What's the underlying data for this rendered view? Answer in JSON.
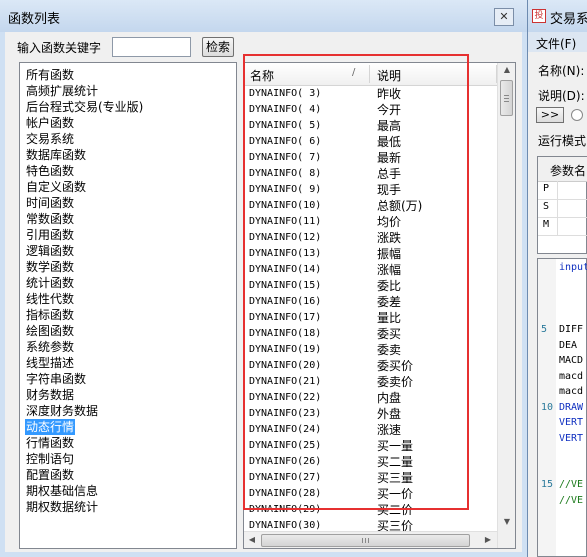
{
  "dialog": {
    "title": "函数列表",
    "close_glyph": "✕",
    "search_label": "输入函数关键字",
    "search_value": "",
    "search_button": "检索"
  },
  "categories": [
    "所有函数",
    "高频扩展统计",
    "后台程式交易(专业版)",
    "帐户函数",
    "交易系统",
    "数据库函数",
    "特色函数",
    "自定义函数",
    "时间函数",
    "常数函数",
    "引用函数",
    "逻辑函数",
    "数学函数",
    "统计函数",
    "线性代数",
    "指标函数",
    "绘图函数",
    "系统参数",
    "线型描述",
    "字符串函数",
    "财务数据",
    "深度财务数据",
    "动态行情",
    "行情函数",
    "控制语句",
    "配置函数",
    "期权基础信息",
    "期权数据统计"
  ],
  "selected_category_index": 22,
  "table": {
    "columns": {
      "name": "名称",
      "sort_glyph": "/",
      "desc": "说明"
    },
    "rows": [
      {
        "name": "DYNAINFO( 3)",
        "desc": "昨收"
      },
      {
        "name": "DYNAINFO( 4)",
        "desc": "今开"
      },
      {
        "name": "DYNAINFO( 5)",
        "desc": "最高"
      },
      {
        "name": "DYNAINFO( 6)",
        "desc": "最低"
      },
      {
        "name": "DYNAINFO( 7)",
        "desc": "最新"
      },
      {
        "name": "DYNAINFO( 8)",
        "desc": "总手"
      },
      {
        "name": "DYNAINFO( 9)",
        "desc": "现手"
      },
      {
        "name": "DYNAINFO(10)",
        "desc": "总额(万)"
      },
      {
        "name": "DYNAINFO(11)",
        "desc": "均价"
      },
      {
        "name": "DYNAINFO(12)",
        "desc": "涨跌"
      },
      {
        "name": "DYNAINFO(13)",
        "desc": "振幅"
      },
      {
        "name": "DYNAINFO(14)",
        "desc": "涨幅"
      },
      {
        "name": "DYNAINFO(15)",
        "desc": "委比"
      },
      {
        "name": "DYNAINFO(16)",
        "desc": "委差"
      },
      {
        "name": "DYNAINFO(17)",
        "desc": "量比"
      },
      {
        "name": "DYNAINFO(18)",
        "desc": "委买"
      },
      {
        "name": "DYNAINFO(19)",
        "desc": "委卖"
      },
      {
        "name": "DYNAINFO(20)",
        "desc": "委买价"
      },
      {
        "name": "DYNAINFO(21)",
        "desc": "委卖价"
      },
      {
        "name": "DYNAINFO(22)",
        "desc": "内盘"
      },
      {
        "name": "DYNAINFO(23)",
        "desc": "外盘"
      },
      {
        "name": "DYNAINFO(24)",
        "desc": "涨速"
      },
      {
        "name": "DYNAINFO(25)",
        "desc": "买一量"
      },
      {
        "name": "DYNAINFO(26)",
        "desc": "买二量"
      },
      {
        "name": "DYNAINFO(27)",
        "desc": "买三量"
      },
      {
        "name": "DYNAINFO(28)",
        "desc": "买一价"
      },
      {
        "name": "DYNAINFO(29)",
        "desc": "买二价"
      },
      {
        "name": "DYNAINFO(30)",
        "desc": "买三价"
      }
    ]
  },
  "scroll_glyphs": {
    "up": "▲",
    "down": "▼",
    "left": "◀",
    "right": "▶"
  },
  "bg_window": {
    "title": "交易系",
    "app_icon_glyph": "投",
    "menu_file": "文件(F)",
    "name_label": "名称(N):",
    "desc_label": "说明(D):",
    "nav_button": ">>",
    "mode_label": "运行模式",
    "param_header": "参数名",
    "params": [
      "P",
      "S",
      "M"
    ],
    "code_lines": [
      {
        "ln": "",
        "text": "input",
        "style": "blue"
      },
      {
        "ln": "",
        "text": "",
        "style": ""
      },
      {
        "ln": "",
        "text": "",
        "style": ""
      },
      {
        "ln": "",
        "text": "",
        "style": ""
      },
      {
        "ln": "5",
        "text": "DIFF",
        "style": ""
      },
      {
        "ln": "",
        "text": "DEA ",
        "style": ""
      },
      {
        "ln": "",
        "text": "MACD",
        "style": ""
      },
      {
        "ln": "",
        "text": "macd",
        "style": ""
      },
      {
        "ln": "",
        "text": "macd",
        "style": ""
      },
      {
        "ln": "10",
        "text": "DRAW",
        "style": "blue"
      },
      {
        "ln": "",
        "text": "VERT",
        "style": "blue"
      },
      {
        "ln": "",
        "text": "VERT",
        "style": "blue"
      },
      {
        "ln": "",
        "text": "",
        "style": ""
      },
      {
        "ln": "",
        "text": "",
        "style": ""
      },
      {
        "ln": "15",
        "text": "//VE",
        "style": "green"
      },
      {
        "ln": "",
        "text": "//VE",
        "style": "green"
      }
    ]
  }
}
